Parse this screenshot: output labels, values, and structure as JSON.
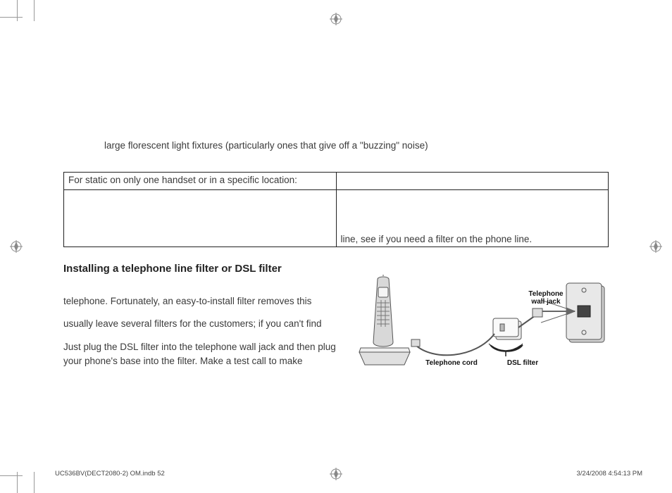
{
  "lead_continuation": "large florescent light fixtures (particularly ones that give off a \"buzzing\" noise)",
  "table": {
    "row1_left": "For static on only one handset or in a specific location:",
    "row1_right": "",
    "row2_left": "",
    "row2_right_bottom": "line, see if you need a filter on the phone line."
  },
  "section_heading": "Installing a telephone line filter or DSL filter",
  "para1_line1": "telephone. Fortunately, an easy-to-install filter removes this",
  "para2_line1": "usually leave several filters for the customers; if you can't find",
  "para3": "Just plug the DSL filter into the telephone wall jack and then plug your phone's base into the filter. Make a test call to make",
  "diagram": {
    "cord_label": "Telephone cord",
    "filter_label": "DSL filter",
    "jack_label": "Telephone\nwall jack"
  },
  "footer": {
    "left": "UC536BV(DECT2080-2) OM.indb   52",
    "right": "3/24/2008   4:54:13 PM"
  }
}
